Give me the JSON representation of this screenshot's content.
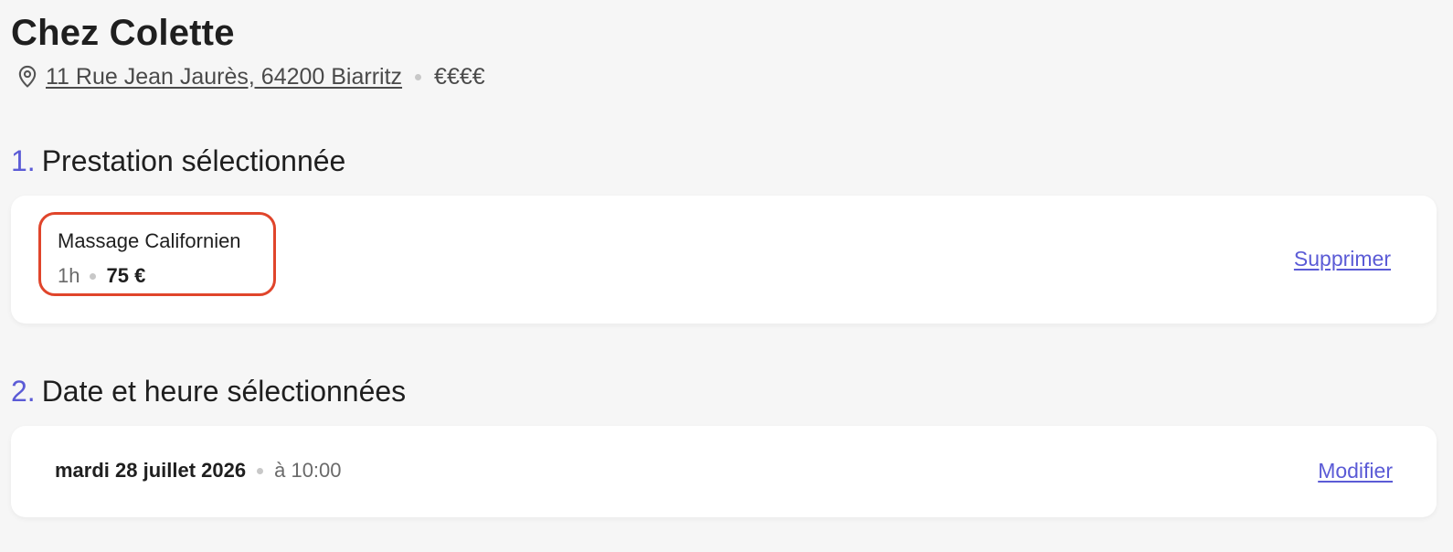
{
  "salon": {
    "name": "Chez Colette",
    "address": "11 Rue Jean Jaurès, 64200 Biarritz",
    "price_level": "€€€€"
  },
  "sections": [
    {
      "number": "1.",
      "title": "Prestation sélectionnée",
      "service": {
        "name": "Massage Californien",
        "duration": "1h",
        "price": "75 €"
      },
      "action_label": "Supprimer"
    },
    {
      "number": "2.",
      "title": "Date et heure sélectionnées",
      "date": "mardi 28 juillet 2026",
      "time": "à 10:00",
      "action_label": "Modifier"
    }
  ],
  "colors": {
    "accent": "#5b5bd6",
    "highlight_border": "#e0452b",
    "background": "#f6f6f6",
    "card": "#ffffff"
  },
  "icons": {
    "location": "map-pin-icon"
  }
}
